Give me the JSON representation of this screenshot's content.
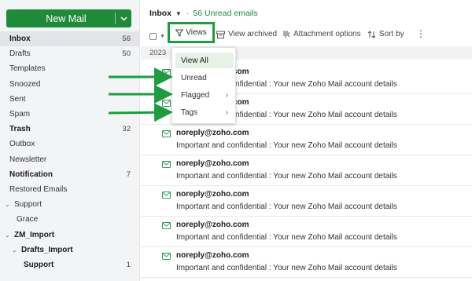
{
  "colors": {
    "accent": "#1f8b3a",
    "annotation": "#1f9c3f"
  },
  "sidebar": {
    "new_mail_label": "New Mail",
    "folders": [
      {
        "name": "Inbox",
        "count": "56",
        "bold": true,
        "active": true
      },
      {
        "name": "Drafts",
        "count": "50"
      },
      {
        "name": "Templates",
        "count": ""
      },
      {
        "name": "Snoozed",
        "count": ""
      },
      {
        "name": "Sent",
        "count": ""
      },
      {
        "name": "Spam",
        "count": ""
      },
      {
        "name": "Trash",
        "count": "32",
        "bold": true
      },
      {
        "name": "Outbox",
        "count": ""
      },
      {
        "name": "Newsletter",
        "count": ""
      },
      {
        "name": "Notification",
        "count": "7",
        "bold": true
      },
      {
        "name": "Restored Emails",
        "count": ""
      },
      {
        "name": "Support",
        "count": "",
        "caret": "v"
      },
      {
        "name": "Grace",
        "count": "",
        "indent": 1
      },
      {
        "name": "ZM_Import",
        "count": "",
        "bold": true,
        "caret": "v"
      },
      {
        "name": "Drafts_Import",
        "count": "",
        "bold": true,
        "caret": "v",
        "indent": 1
      },
      {
        "name": "Support",
        "count": "1",
        "bold": true,
        "indent": 2
      }
    ]
  },
  "header": {
    "folder": "Inbox",
    "unread": "56 Unread emails"
  },
  "toolbar": {
    "views_label": "Views",
    "view_archived_label": "View archived",
    "attachment_options_label": "Attachment options",
    "sort_by_label": "Sort by"
  },
  "year_group": "2023",
  "views_menu": {
    "items": [
      {
        "label": "View All",
        "selected": true,
        "submenu": false
      },
      {
        "label": "Unread",
        "submenu": false
      },
      {
        "label": "Flagged",
        "submenu": true
      },
      {
        "label": "Tags",
        "submenu": true
      }
    ]
  },
  "mails": [
    {
      "from": "noreply@zoho.com",
      "subject": "Important and confidential : Your new Zoho Mail account details"
    },
    {
      "from": "noreply@zoho.com",
      "subject": "Important and confidential : Your new Zoho Mail account details"
    },
    {
      "from": "noreply@zoho.com",
      "subject": "Important and confidential : Your new Zoho Mail account details"
    },
    {
      "from": "noreply@zoho.com",
      "subject": "Important and confidential : Your new Zoho Mail account details"
    },
    {
      "from": "noreply@zoho.com",
      "subject": "Important and confidential : Your new Zoho Mail account details"
    },
    {
      "from": "noreply@zoho.com",
      "subject": "Important and confidential : Your new Zoho Mail account details"
    },
    {
      "from": "noreply@zoho.com",
      "subject": "Important and confidential : Your new Zoho Mail account details"
    }
  ]
}
